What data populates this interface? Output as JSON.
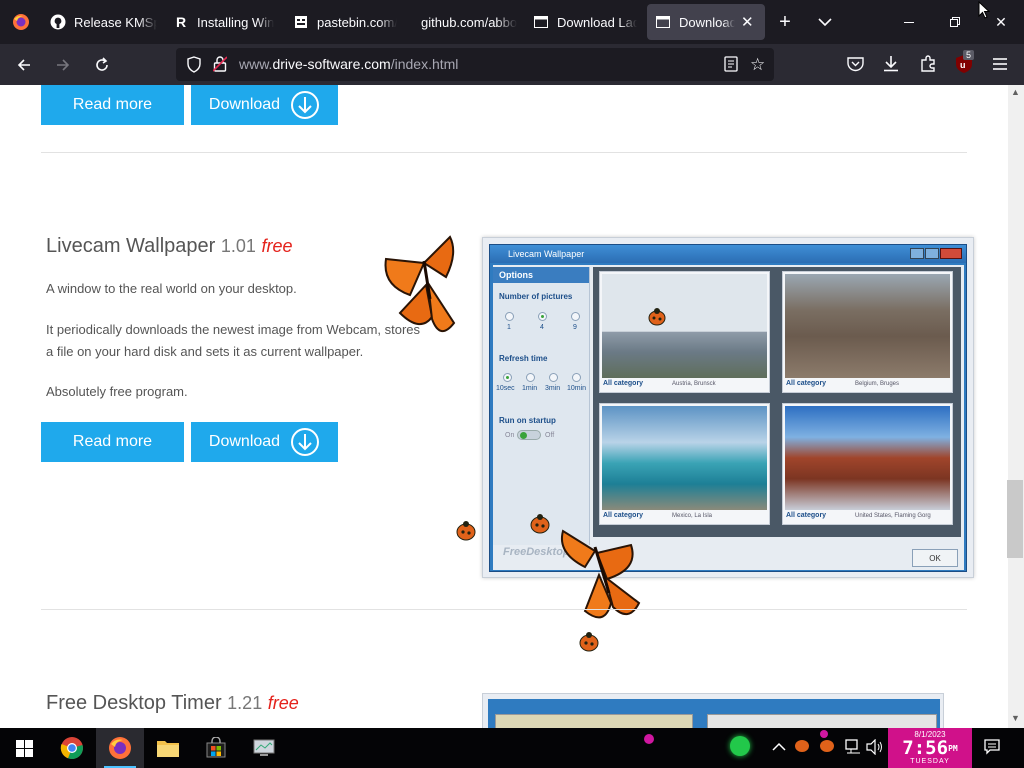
{
  "browser": {
    "tabs": [
      {
        "label": "Release KMSp",
        "icon": "github-icon",
        "active": false
      },
      {
        "label": "Installing Win",
        "icon": "r-icon",
        "active": false
      },
      {
        "label": "pastebin.com/",
        "icon": "pastebin-icon",
        "active": false
      },
      {
        "label": "github.com/abbo",
        "icon": "none",
        "active": false
      },
      {
        "label": "Download Lad",
        "icon": "page-icon",
        "active": false
      },
      {
        "label": "Download A",
        "icon": "page-icon",
        "active": true
      }
    ],
    "url_dim": "www.",
    "url_host": "drive-software.com",
    "url_path": "/index.html",
    "extension_badge": "5"
  },
  "page": {
    "top_buttons": {
      "read_more": "Read more",
      "download": "Download"
    },
    "product1": {
      "name": "Livecam Wallpaper",
      "version": "1.01",
      "price": "free",
      "p1": "A window to the real world on your desktop.",
      "p2a": "It periodically downloads the newest image from Webcam, stores",
      "p2b": "a file on your hard disk and sets it as current wallpaper.",
      "p3": "Absolutely free program.",
      "read_more": "Read more",
      "download": "Download"
    },
    "screenshot": {
      "title": "Livecam Wallpaper",
      "options": "Options",
      "num_pictures": "Number of pictures",
      "num_opts": [
        "1",
        "4",
        "9"
      ],
      "refresh": "Refresh time",
      "refresh_opts": [
        "10sec",
        "1min",
        "3min",
        "10min"
      ],
      "startup": "Run on startup",
      "on": "On",
      "off": "Off",
      "cells": [
        {
          "cat": "All category",
          "loc": "Austria, Brunsck"
        },
        {
          "cat": "All category",
          "loc": "Belgium, Bruges"
        },
        {
          "cat": "All category",
          "loc": "Mexico, La Isla"
        },
        {
          "cat": "All category",
          "loc": "United States, Flaming Gorg"
        }
      ],
      "ok": "OK",
      "watermark": "FreeDesktopSo"
    },
    "product2": {
      "name": "Free Desktop Timer",
      "version": "1.21",
      "price": "free"
    }
  },
  "taskbar": {
    "date": "8/1/2023",
    "time": "7:56",
    "ampm": "PM",
    "day": "TUESDAY"
  }
}
